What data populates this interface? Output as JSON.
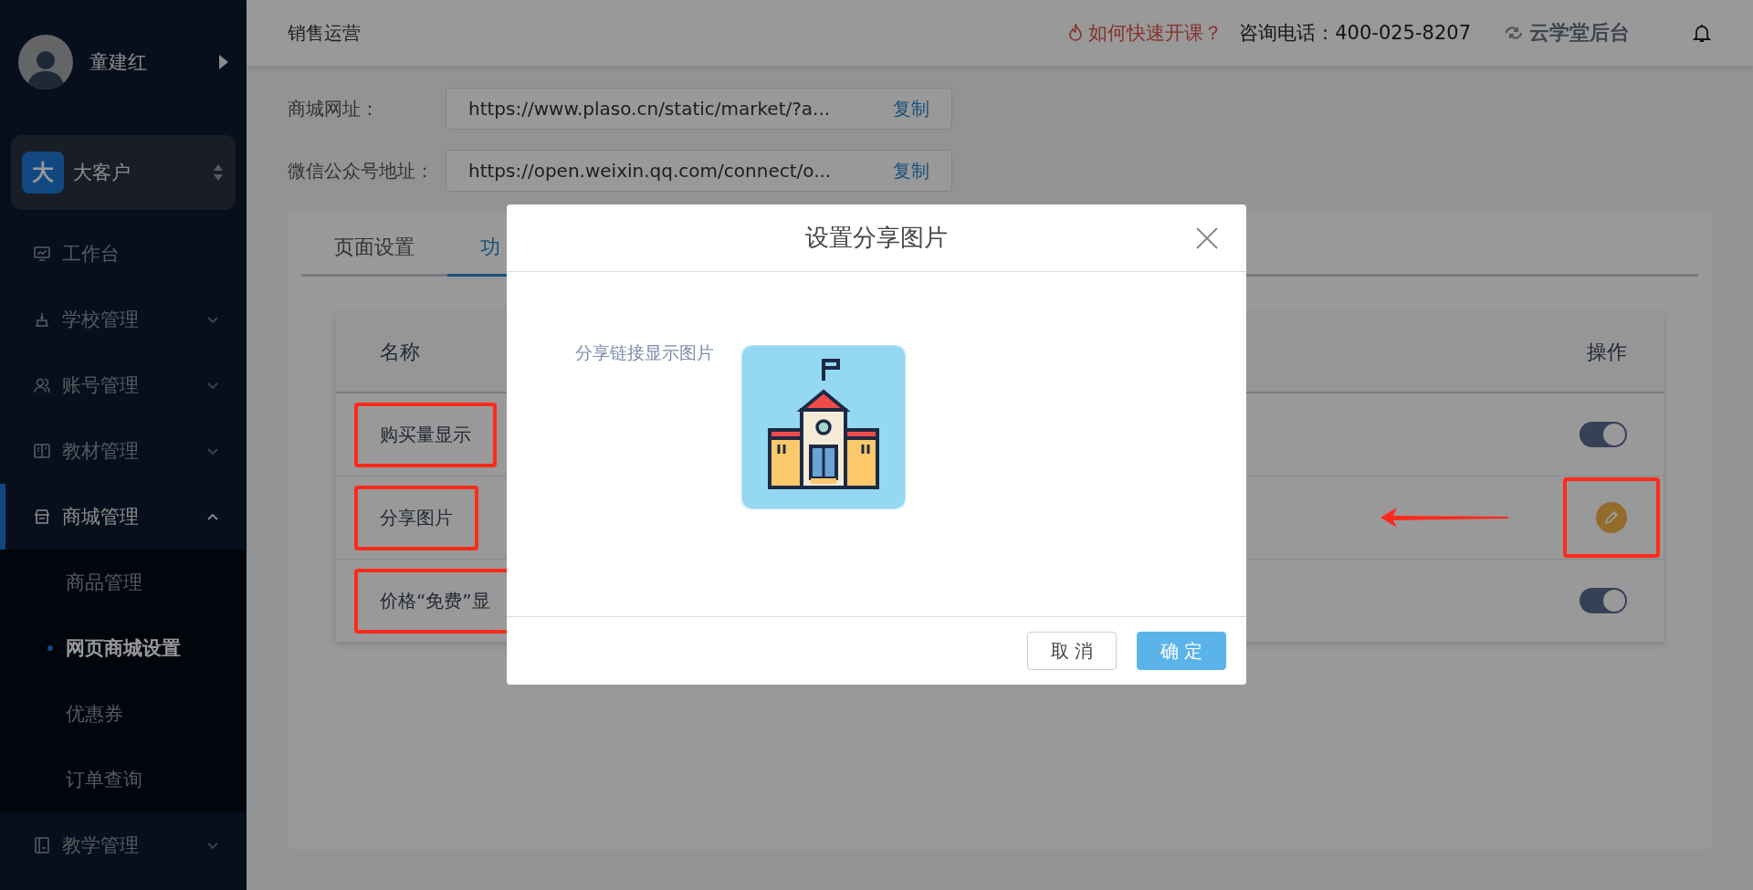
{
  "sidebar": {
    "user": {
      "name": "童建红"
    },
    "org": {
      "badge": "大",
      "name": "大客户"
    },
    "items": [
      {
        "label": "工作台",
        "selected": false
      },
      {
        "label": "学校管理",
        "selected": false,
        "expanded": false
      },
      {
        "label": "账号管理",
        "selected": false,
        "expanded": false
      },
      {
        "label": "教材管理",
        "selected": false,
        "expanded": false
      },
      {
        "label": "商城管理",
        "selected": true,
        "expanded": true,
        "children": [
          {
            "label": "商品管理",
            "selected": false
          },
          {
            "label": "网页商城设置",
            "selected": true
          },
          {
            "label": "优惠券",
            "selected": false
          },
          {
            "label": "订单查询",
            "selected": false
          }
        ]
      },
      {
        "label": "教学管理",
        "selected": false,
        "expanded": false
      }
    ]
  },
  "header": {
    "title": "销售运营",
    "help_link": "如何快速开课？",
    "phone": "咨询电话：400-025-8207",
    "brand": "云学堂后台"
  },
  "fields": [
    {
      "label": "商城网址：",
      "value": "https://www.plaso.cn/static/market/?a...",
      "action": "复制"
    },
    {
      "label": "微信公众号地址：",
      "value": "https://open.weixin.qq.com/connect/o...",
      "action": "复制"
    }
  ],
  "tabs": [
    {
      "label": "页面设置",
      "selected": false
    },
    {
      "label": "功",
      "selected": true
    }
  ],
  "table": {
    "columns": [
      "名称",
      "操作"
    ],
    "rows": [
      {
        "name": "购买量显示",
        "kind": "switch",
        "on": true,
        "boxed": true
      },
      {
        "name": "分享图片",
        "kind": "edit",
        "boxed": true,
        "action_boxed": true,
        "arrow": true
      },
      {
        "name": "价格“免费”显",
        "kind": "switch",
        "on": true,
        "boxed": true
      }
    ]
  },
  "modal": {
    "title": "设置分享图片",
    "label": "分享链接显示图片",
    "buttons": [
      {
        "label": "取 消",
        "kind": "secondary"
      },
      {
        "label": "确 定",
        "kind": "primary"
      }
    ]
  }
}
